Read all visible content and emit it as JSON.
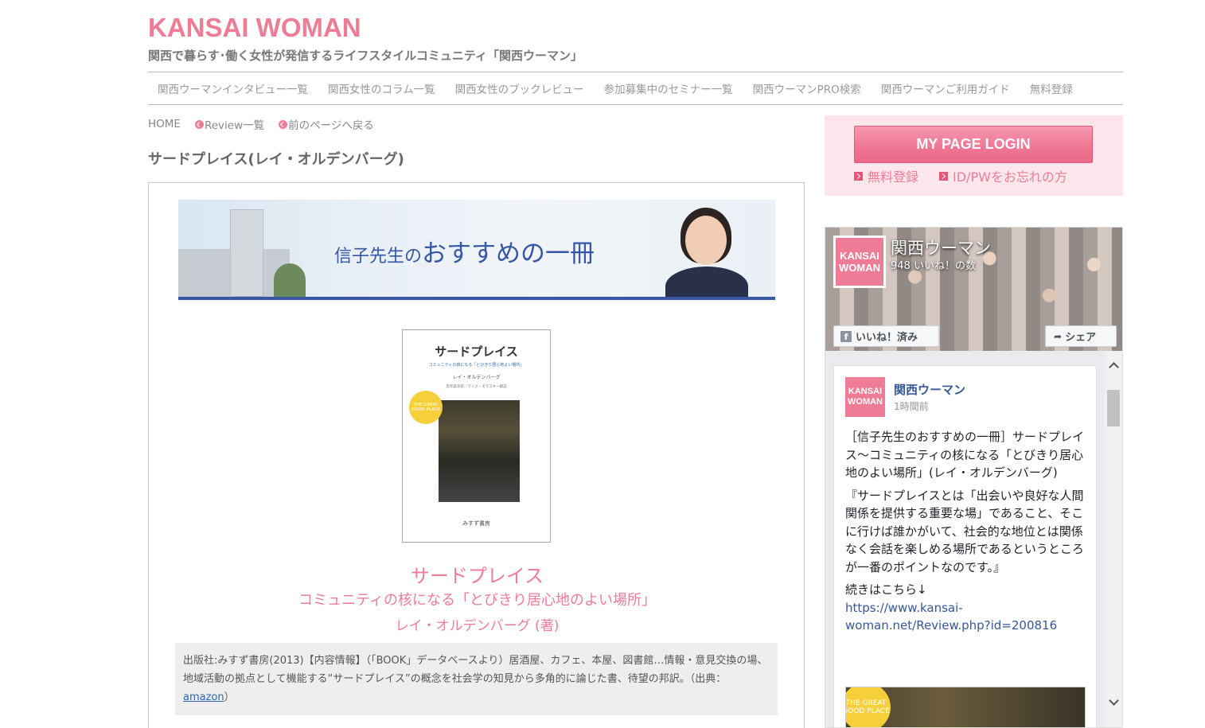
{
  "header": {
    "logo": "KANSAI WOMAN",
    "tagline": "関西で暮らす･働く女性が発信するライフスタイルコミュニティ「関西ウーマン」"
  },
  "nav": {
    "items": [
      "関西ウーマンインタビュー一覧",
      "関西女性のコラム一覧",
      "関西女性のブックレビュー",
      "参加募集中のセミナー一覧",
      "関西ウーマンPRO検索",
      "関西ウーマンご利用ガイド",
      "無料登録"
    ]
  },
  "breadcrumb": {
    "home": "HOME",
    "review": "Review一覧",
    "back": "前のページへ戻る"
  },
  "page": {
    "title": "サードプレイス(レイ・オルデンバーグ)"
  },
  "banner": {
    "text_small": "信子先生の",
    "text_big": "おすすめの一冊"
  },
  "book_cover": {
    "title": "サードプレイス",
    "subtitle": "コミュニティの核になる「とびきり居心地よい場所」",
    "author": "レイ・オルデンバーグ",
    "translator": "忠平美幸訳／マイク・モラスキー解説",
    "badge": "THE GREAT GOOD PLACE",
    "publisher": "みすず書房"
  },
  "book": {
    "title": "サードプレイス",
    "subtitle": "コミュニティの核になる「とびきり居心地のよい場所」",
    "author": "レイ・オルデンバーグ (著)",
    "info_text": "出版社:みすず書房(2013)【内容情報】（「BOOK」データベースより）居酒屋、カフェ、本屋、図書館…情報・意見交換の場、地域活動の拠点として機能する“サードプレイス”の概念を社会学の知見から多角的に論じた書、待望の邦訳。（出典：",
    "info_link": "amazon",
    "info_end": "）"
  },
  "login": {
    "button": "MY PAGE LOGIN",
    "register": "無料登録",
    "forgot": "ID/PWをお忘れの方"
  },
  "facebook": {
    "logo_text": "KANSAI WOMAN",
    "page_name": "関西ウーマン",
    "likes": "948 いいね！の数",
    "like_button": "いいね！済み",
    "share_button": "シェア",
    "post": {
      "author": "関西ウーマン",
      "time": "1時間前",
      "para1": "［信子先生のおすすめの一冊］サードプレイス～コミュニティの核になる「とびきり居心地のよい場所」(レイ・オルデンバーグ)",
      "para2": "『サードプレイスとは「出会いや良好な人間関係を提供する重要な場」であること、そこに行けば誰かがいて、社会的な地位とは関係なく会話を楽しめる場所であるというところが一番のポイントなのです。』",
      "para3": "続きはこちら↓",
      "link": "https://www.kansai-woman.net/Review.php?id=200816",
      "image_badge": "THE GREAT GOOD PLACE"
    }
  }
}
